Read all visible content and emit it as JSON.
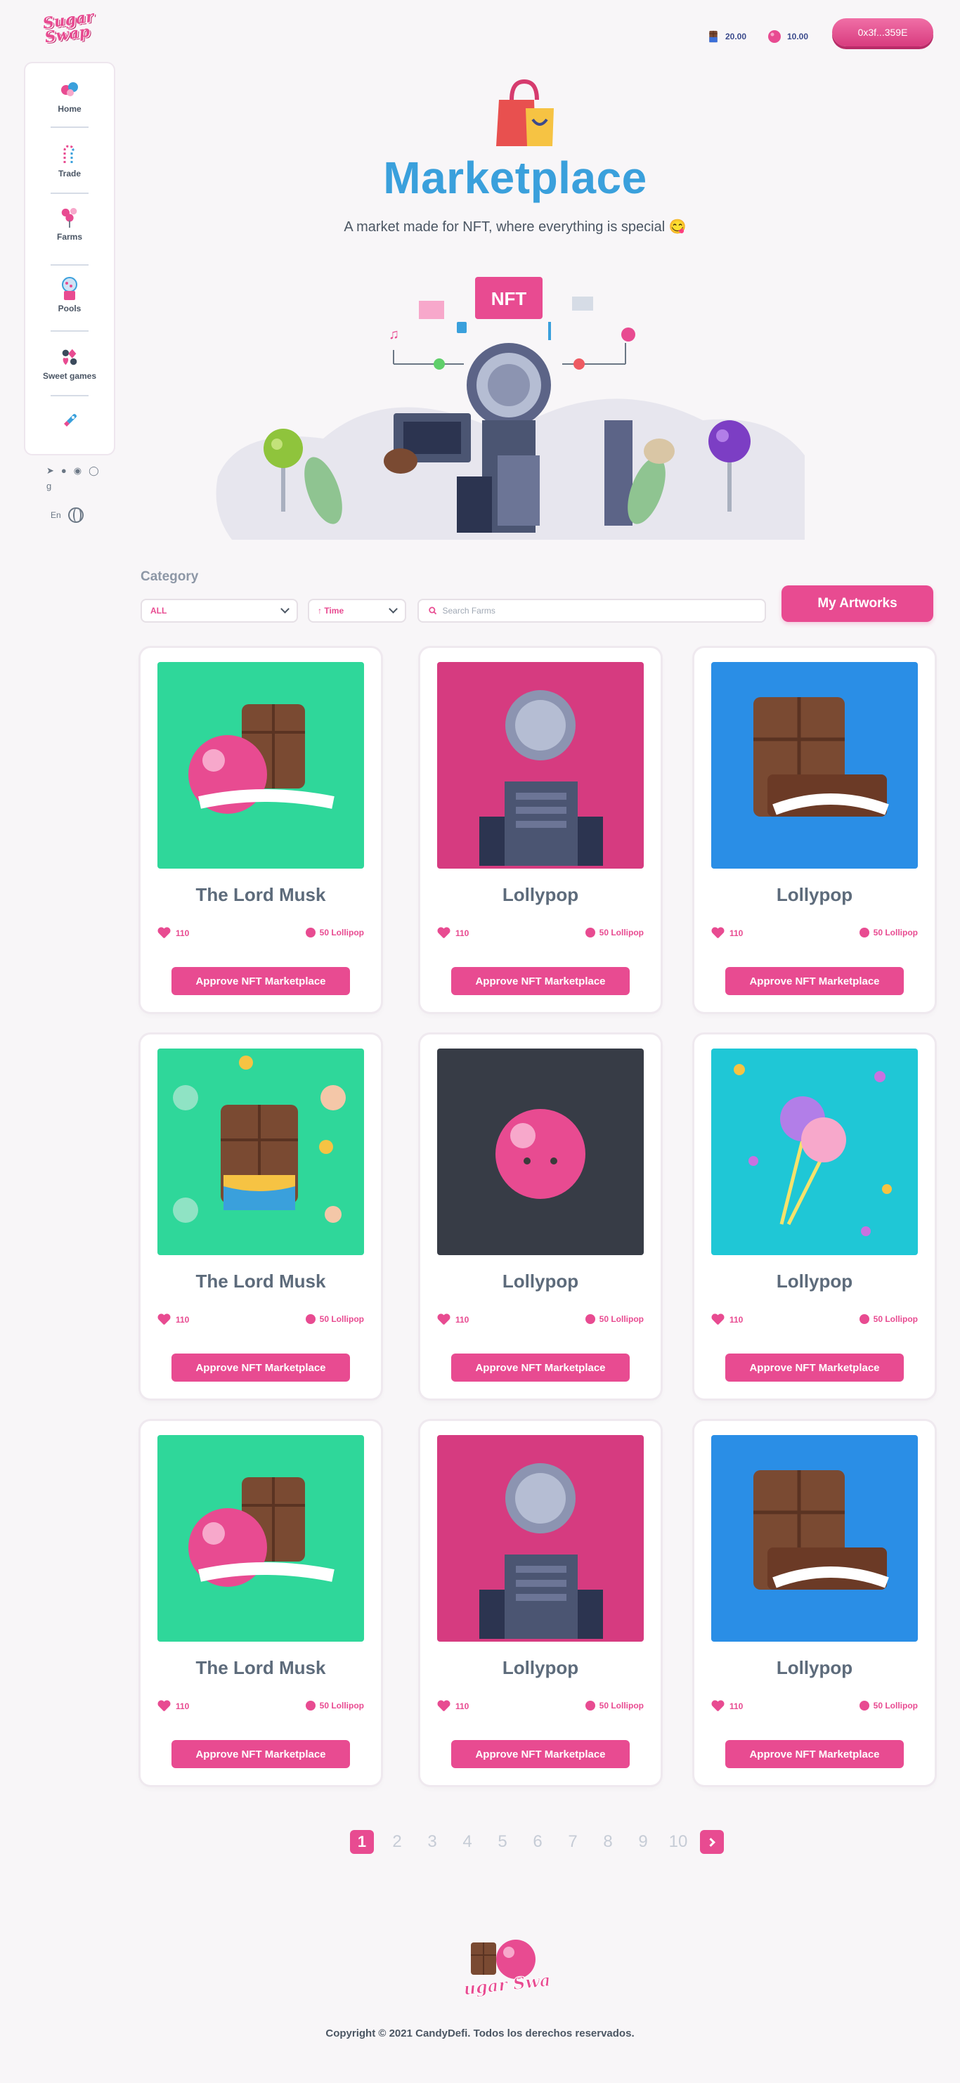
{
  "brand": {
    "logo_text": "Sugar Swap"
  },
  "header": {
    "balance_choco": "20.00",
    "balance_lolly": "10.00",
    "wallet_address": "0x3f...359E"
  },
  "sidebar": {
    "items": [
      {
        "label": "Home",
        "icon": "candies-icon"
      },
      {
        "label": "Trade",
        "icon": "candy-cane-icon"
      },
      {
        "label": "Farms",
        "icon": "candy-tree-icon"
      },
      {
        "label": "Pools",
        "icon": "gumball-machine-icon"
      },
      {
        "label": "Sweet games",
        "icon": "cards-suits-icon"
      },
      {
        "label": "",
        "icon": "rocket-icon"
      }
    ]
  },
  "social": [
    "telegram",
    "twitter",
    "reddit",
    "github",
    "gitbook"
  ],
  "language": "En",
  "hero": {
    "title": "Marketplace",
    "subtitle": "A market made for NFT, where everything is special 😋",
    "badge": "NFT"
  },
  "filters": {
    "category_label": "Category",
    "category_value": "ALL",
    "sort_value": "↑ Time",
    "search_placeholder": "Search Farms",
    "my_artworks": "My Artworks"
  },
  "cards": [
    {
      "name": "The Lord Musk",
      "likes": "110",
      "price": "50 Lollipop",
      "action": "Approve NFT Marketplace",
      "art": "choco-lollipop",
      "bg": "#2fd79a"
    },
    {
      "name": "Lollypop",
      "likes": "110",
      "price": "50 Lollipop",
      "action": "Approve NFT Marketplace",
      "art": "robot-server",
      "bg": "#d63b80"
    },
    {
      "name": "Lollypop",
      "likes": "110",
      "price": "50 Lollipop",
      "action": "Approve NFT Marketplace",
      "art": "choco-bar",
      "bg": "#2a8ee6"
    },
    {
      "name": "The Lord Musk",
      "likes": "110",
      "price": "50 Lollipop",
      "action": "Approve NFT Marketplace",
      "art": "choco-candies",
      "bg": "#2fd79a"
    },
    {
      "name": "Lollypop",
      "likes": "110",
      "price": "50 Lollipop",
      "action": "Approve NFT Marketplace",
      "art": "pink-lolly",
      "bg": "#373c46"
    },
    {
      "name": "Lollypop",
      "likes": "110",
      "price": "50 Lollipop",
      "action": "Approve NFT Marketplace",
      "art": "double-lolly",
      "bg": "#1fc7d6"
    },
    {
      "name": "The Lord Musk",
      "likes": "110",
      "price": "50 Lollipop",
      "action": "Approve NFT Marketplace",
      "art": "choco-lollipop",
      "bg": "#2fd79a"
    },
    {
      "name": "Lollypop",
      "likes": "110",
      "price": "50 Lollipop",
      "action": "Approve NFT Marketplace",
      "art": "robot-server",
      "bg": "#d63b80"
    },
    {
      "name": "Lollypop",
      "likes": "110",
      "price": "50 Lollipop",
      "action": "Approve NFT Marketplace",
      "art": "choco-bar",
      "bg": "#2a8ee6"
    }
  ],
  "pagination": {
    "current": "1",
    "pages": [
      "2",
      "3",
      "4",
      "5",
      "6",
      "7",
      "8",
      "9",
      "10"
    ]
  },
  "footer": {
    "copyright": "Copyright © 2021 CandyDefi. Todos los derechos reservados."
  },
  "colors": {
    "accent": "#e84b91",
    "title_blue": "#3aa0dc",
    "text": "#5d6b7b"
  }
}
